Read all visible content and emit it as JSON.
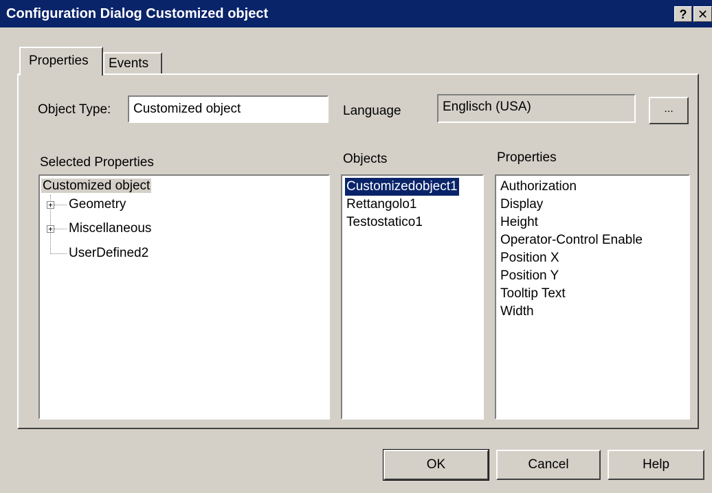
{
  "window": {
    "title": "Configuration Dialog Customized object",
    "help_button": "?",
    "close_button": "✕"
  },
  "tabs": [
    {
      "label": "Properties",
      "active": true
    },
    {
      "label": "Events",
      "active": false
    }
  ],
  "form": {
    "object_type_label": "Object Type:",
    "object_type_value": "Customized object",
    "language_label": "Language",
    "language_value": "Englisch (USA)",
    "browse_button": "..."
  },
  "selected_properties": {
    "label": "Selected Properties",
    "root": "Customized object",
    "nodes": [
      {
        "label": "Geometry",
        "expandable": true,
        "expander": "+"
      },
      {
        "label": "Miscellaneous",
        "expandable": true,
        "expander": "+"
      },
      {
        "label": "UserDefined2",
        "expandable": false
      }
    ]
  },
  "objects": {
    "label": "Objects",
    "items": [
      "Customizedobject1",
      "Rettangolo1",
      "Testostatico1"
    ],
    "selected_index": 0
  },
  "properties": {
    "label": "Properties",
    "items": [
      "Authorization",
      "Display",
      "Height",
      "Operator-Control Enable",
      "Position X",
      "Position Y",
      "Tooltip Text",
      "Width"
    ]
  },
  "buttons": {
    "ok": "OK",
    "cancel": "Cancel",
    "help": "Help"
  },
  "colors": {
    "titlebar": "#0a246a",
    "face": "#d4d0c8",
    "selection": "#0a246a"
  }
}
